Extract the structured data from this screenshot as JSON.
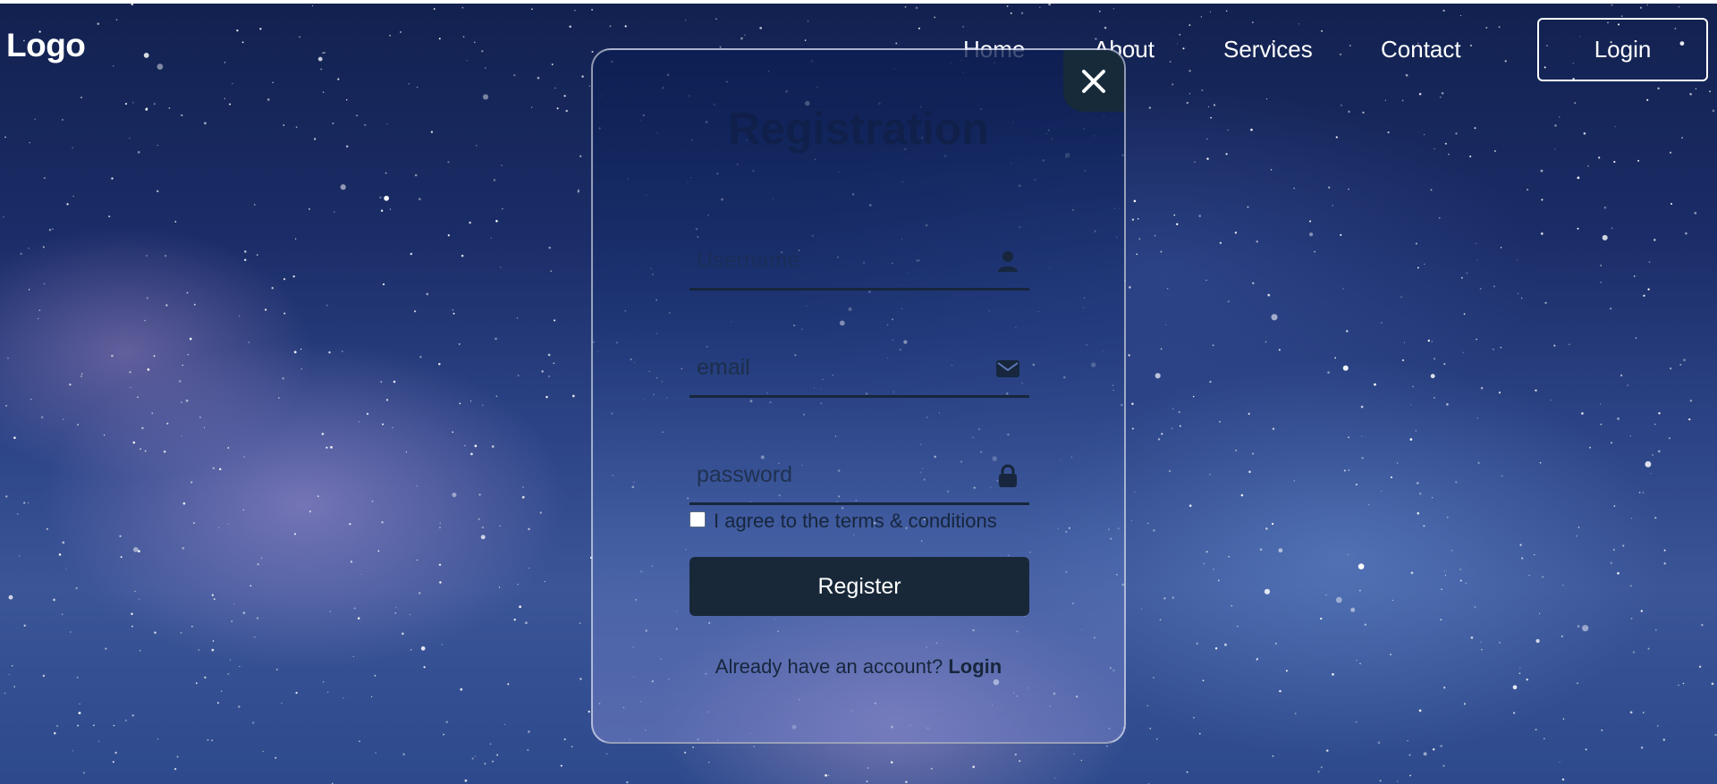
{
  "nav": {
    "logo": "Logo",
    "links": [
      "Home",
      "About",
      "Services",
      "Contact"
    ],
    "login_button": "Login"
  },
  "modal": {
    "title": "Registration",
    "username": {
      "placeholder": "Username",
      "icon": "person-icon"
    },
    "email": {
      "placeholder": "email",
      "icon": "envelope-icon"
    },
    "password": {
      "placeholder": "password",
      "icon": "lock-icon"
    },
    "terms_label": "I agree to the terms & conditions",
    "terms_checked": false,
    "register_button": "Register",
    "login_prompt": "Already have an account?",
    "login_link": "Login",
    "close_icon": "close-icon"
  },
  "colors": {
    "button_dark": "#182839",
    "text_dark": "#17263c",
    "nav_text": "#ffffff"
  }
}
